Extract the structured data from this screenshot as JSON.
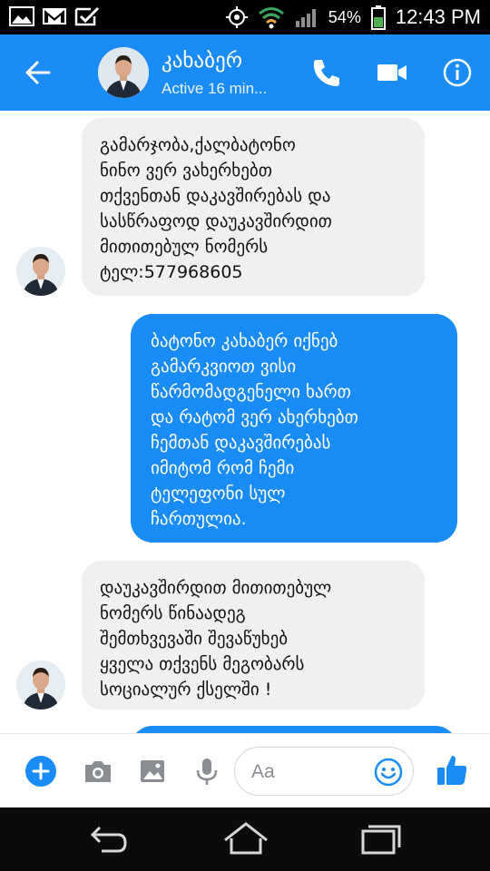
{
  "status_bar": {
    "battery_percent": "54%",
    "time": "12:43 PM",
    "icons": [
      "image-icon",
      "gmail-icon",
      "tasks-icon",
      "gps-icon",
      "wifi-icon",
      "signal-icon",
      "battery-icon"
    ]
  },
  "header": {
    "contact_name": "კახაბერ",
    "contact_status": "Active 16 min...",
    "accent_color": "#1a8cf7",
    "icons": [
      "back-arrow-icon",
      "phone-icon",
      "video-camera-icon",
      "info-icon"
    ]
  },
  "messages": [
    {
      "direction": "incoming",
      "lines": [
        "გამარჯობა,ქალბატონო",
        "ნინო ვერ ვახერხებთ",
        "თქვენთან დაკავშირებას და",
        "სასწრაფოდ დაუკავშირდით",
        "მითითებულ ნომერს",
        "ტელ:577968605"
      ]
    },
    {
      "direction": "outgoing",
      "lines": [
        "ბატონო კახაბერ იქნებ",
        "გამარკვიოთ ვისი",
        "წარმომადგენელი ხართ",
        "და რატომ ვერ ახერხებთ",
        "ჩემთან დაკავშირებას",
        "იმიტომ რომ ჩემი",
        "ტელეფონი სულ",
        "ჩართულია."
      ]
    },
    {
      "direction": "incoming",
      "lines": [
        "დაუკავშირდით მითითებულ",
        "ნომერს წინაადეგ",
        "შემთხვევაში შევაწუხებ",
        "ყველა თქვენს მეგობარს",
        "სოციალურ ქსელში !"
      ]
    }
  ],
  "composer": {
    "placeholder": "Aa",
    "icons": [
      "plus-icon",
      "camera-icon",
      "gallery-icon",
      "microphone-icon",
      "emoji-icon",
      "thumbs-up-icon"
    ]
  },
  "navbar": {
    "icons": [
      "nav-back-icon",
      "nav-home-icon",
      "nav-recents-icon"
    ]
  }
}
